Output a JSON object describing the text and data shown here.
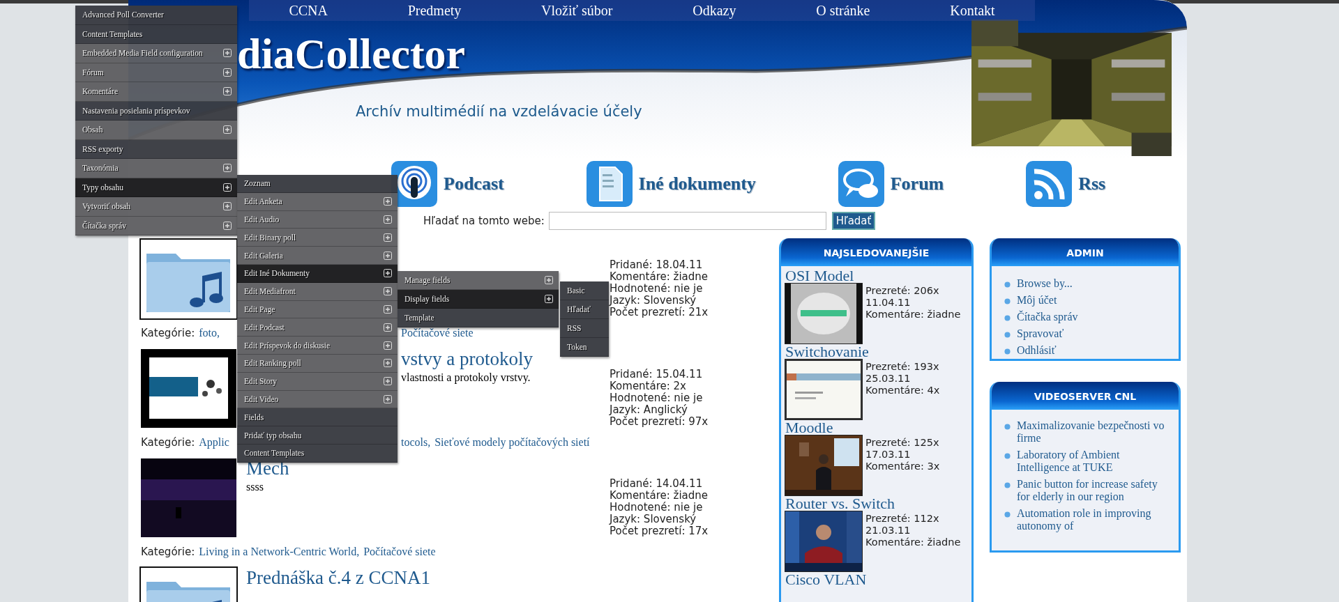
{
  "nav": [
    {
      "label": "CCNA"
    },
    {
      "label": "Predmety"
    },
    {
      "label": "Vložiť súbor"
    },
    {
      "label": "Odkazy"
    },
    {
      "label": "O stránke"
    },
    {
      "label": "Kontakt"
    }
  ],
  "header": {
    "logo": "diaCollector",
    "subtitle": "Archív multimédií na vzdelávacie účely"
  },
  "admin_menu": {
    "items": [
      {
        "label": "Advanced Poll Converter",
        "has_submenu": false,
        "selected": false
      },
      {
        "label": "Content Templates",
        "has_submenu": false,
        "selected": false
      },
      {
        "label": "Embedded Media Field configuration",
        "has_submenu": true,
        "selected": false
      },
      {
        "label": "Fórum",
        "has_submenu": true,
        "selected": false
      },
      {
        "label": "Komentáre",
        "has_submenu": true,
        "selected": false
      },
      {
        "label": "Nastavenia posielania príspevkov",
        "has_submenu": false,
        "selected": false
      },
      {
        "label": "Obsah",
        "has_submenu": true,
        "selected": false
      },
      {
        "label": "RSS exporty",
        "has_submenu": false,
        "selected": false
      },
      {
        "label": "Taxonómia",
        "has_submenu": true,
        "selected": false
      },
      {
        "label": "Typy obsahu",
        "has_submenu": true,
        "selected": true,
        "children": [
          {
            "label": "Zoznam",
            "has_submenu": false,
            "selected": false
          },
          {
            "label": "Edit Anketa",
            "has_submenu": true,
            "selected": false
          },
          {
            "label": "Edit Audio",
            "has_submenu": true,
            "selected": false
          },
          {
            "label": "Edit Binary poll",
            "has_submenu": true,
            "selected": false
          },
          {
            "label": "Edit Galeria",
            "has_submenu": true,
            "selected": false
          },
          {
            "label": "Edit Iné Dokumenty",
            "has_submenu": true,
            "selected": true,
            "children": [
              {
                "label": "Manage fields",
                "has_submenu": true,
                "selected": false
              },
              {
                "label": "Display fields",
                "has_submenu": true,
                "selected": true,
                "children": [
                  {
                    "label": "Basic",
                    "has_submenu": false,
                    "selected": false
                  },
                  {
                    "label": "Hľadať",
                    "has_submenu": false,
                    "selected": false
                  },
                  {
                    "label": "RSS",
                    "has_submenu": false,
                    "selected": false
                  },
                  {
                    "label": "Token",
                    "has_submenu": false,
                    "selected": false
                  }
                ]
              },
              {
                "label": "Template",
                "has_submenu": false,
                "selected": false
              }
            ]
          },
          {
            "label": "Edit Mediafront",
            "has_submenu": true,
            "selected": false
          },
          {
            "label": "Edit Page",
            "has_submenu": true,
            "selected": false
          },
          {
            "label": "Edit Podcast",
            "has_submenu": true,
            "selected": false
          },
          {
            "label": "Edit Príspevok do diskusie",
            "has_submenu": true,
            "selected": false
          },
          {
            "label": "Edit Ranking poll",
            "has_submenu": true,
            "selected": false
          },
          {
            "label": "Edit Story",
            "has_submenu": true,
            "selected": false
          },
          {
            "label": "Edit Video",
            "has_submenu": true,
            "selected": false
          },
          {
            "label": "Fields",
            "has_submenu": false,
            "selected": false
          },
          {
            "label": "Pridať typ obsahu",
            "has_submenu": false,
            "selected": false
          },
          {
            "label": "Content Templates",
            "has_submenu": false,
            "selected": false
          }
        ]
      },
      {
        "label": "Vytvoriť obsah",
        "has_submenu": true,
        "selected": false
      },
      {
        "label": "Čítačka správ",
        "has_submenu": true,
        "selected": false
      }
    ]
  },
  "categories": [
    {
      "label": "Podcast"
    },
    {
      "label": "Iné dokumenty"
    },
    {
      "label": "Forum"
    },
    {
      "label": "Rss"
    }
  ],
  "search": {
    "label": "Hľadať na tomto webe:",
    "button": "Hľadať"
  },
  "items": [
    {
      "meta": [
        "Pridané: 18.04.11",
        "Komentáre: žiadne",
        "Hodnotené: nie je",
        "Jazyk: Slovenský",
        "Počet prezretí: 21x"
      ],
      "category_label": "Kategórie:",
      "categories": [
        {
          "text": "foto,",
          "past_menu": false
        },
        {
          "text": "Počítačové siete",
          "past_menu": true
        }
      ]
    },
    {
      "title": "vstvy a protokoly",
      "description": "vlastnosti a protokoly vrstvy.",
      "meta": [
        "Pridané: 15.04.11",
        "Komentáre: 2x",
        "Hodnotené: nie je",
        "Jazyk: Anglický",
        "Počet prezretí: 97x"
      ],
      "category_label": "Kategórie:",
      "categories": [
        {
          "text": "Applic",
          "past_menu": false
        },
        {
          "text": "tocols,",
          "past_menu": true
        },
        {
          "text": "Sieťové modely počítačových sietí",
          "past_menu": true
        }
      ]
    },
    {
      "title": "Mech",
      "description": "ssss",
      "meta": [
        "Pridané: 14.04.11",
        "Komentáre: žiadne",
        "Hodnotené: nie je",
        "Jazyk: Slovenský",
        "Počet prezretí: 17x"
      ],
      "category_label": "Kategórie:",
      "categories": [
        {
          "text": "Living in a Network-Centric World,",
          "past_menu": false
        },
        {
          "text": "Počítačové siete",
          "past_menu": false
        }
      ]
    },
    {
      "title": "Prednáška č.4 z CCNA1"
    }
  ],
  "most_viewed": {
    "title": "NAJSLEDOVANEJŠIE",
    "entries": [
      {
        "title": "OSI Model",
        "stats": [
          "Prezreté: 206x",
          "11.04.11",
          "Komentáre: žiadne"
        ]
      },
      {
        "title": "Switchovanie",
        "stats": [
          "Prezreté: 193x",
          "25.03.11",
          "Komentáre: 4x"
        ]
      },
      {
        "title": "Moodle",
        "stats": [
          "Prezreté: 125x",
          "17.03.11",
          "Komentáre: 3x"
        ]
      },
      {
        "title": "Router vs. Switch",
        "stats": [
          "Prezreté: 112x",
          "21.03.11",
          "Komentáre: žiadne"
        ]
      },
      {
        "title": "Cisco VLAN"
      }
    ]
  },
  "admin": {
    "title": "ADMIN",
    "links": [
      "Browse by...",
      "Môj účet",
      "Čítačka správ",
      "Spravovať",
      "Odhlásiť"
    ]
  },
  "videoserver": {
    "title": "VIDEOSERVER CNL",
    "links": [
      "Maximalizovanie bezpečnosti vo firme",
      "Laboratory of Ambient Intelligence at TUKE",
      "Panic button for increase safety for elderly in our region",
      "Automation role in improving autonomy of"
    ]
  }
}
